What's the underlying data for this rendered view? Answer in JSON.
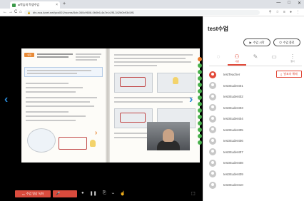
{
  "browser": {
    "tab_title": "ai학습의 학생수업",
    "tab_close": "×",
    "tab_new": "+",
    "win_minimize": "—",
    "win_maximize": "□",
    "win_close": "✕",
    "nav_back": "←",
    "nav_forward": "→",
    "nav_reload": "C",
    "nav_home": "⌂",
    "url": "dtv-eca.lunet.net/pcs001/rooms/5cb-060c9606-0b0b6-4a7e-b2f5-342b0b93d1ff1",
    "addr_icons": [
      "⚲",
      "☆",
      "≡",
      "●",
      "⋮"
    ]
  },
  "stage": {
    "arrow_left": "‹",
    "arrow_right": "›",
    "inner_arrow": "›",
    "page_tag": "실험"
  },
  "toolbar": {
    "record_label": "수업 영상 녹화",
    "record_icon": "▭",
    "mic_icon": "🎤",
    "tool_icons": [
      "●",
      "❚❚",
      "⎘",
      "⌁",
      "☝"
    ],
    "screen_icon": "⬚"
  },
  "panel": {
    "title": "test수업",
    "start_button": "수업 시작",
    "start_icon": "▶",
    "end_button": "수업 종료",
    "end_icon": "⏻",
    "tabs": [
      {
        "icon": "◌",
        "label": ""
      },
      {
        "icon": "⚇",
        "label": "사람"
      },
      {
        "icon": "✎",
        "label": ""
      },
      {
        "icon": "▭",
        "label": ""
      },
      {
        "icon": "⋮",
        "label": "빨아"
      }
    ],
    "participants": [
      {
        "name": "testTeacher",
        "teacher": true
      },
      {
        "name": "testStudent01"
      },
      {
        "name": "testStudent02"
      },
      {
        "name": "testStudent03"
      },
      {
        "name": "testStudent04"
      },
      {
        "name": "testStudent05"
      },
      {
        "name": "testStudent06"
      },
      {
        "name": "testStudent07"
      },
      {
        "name": "testStudent08"
      },
      {
        "name": "testStudent09"
      },
      {
        "name": "testStudent10"
      }
    ],
    "teacher_tag": "발표자 해제",
    "teacher_tag_icon": "▯"
  },
  "colors": {
    "accent": "#e24a3a",
    "arrow": "#2a8ad8",
    "orange": "#e88a37"
  }
}
